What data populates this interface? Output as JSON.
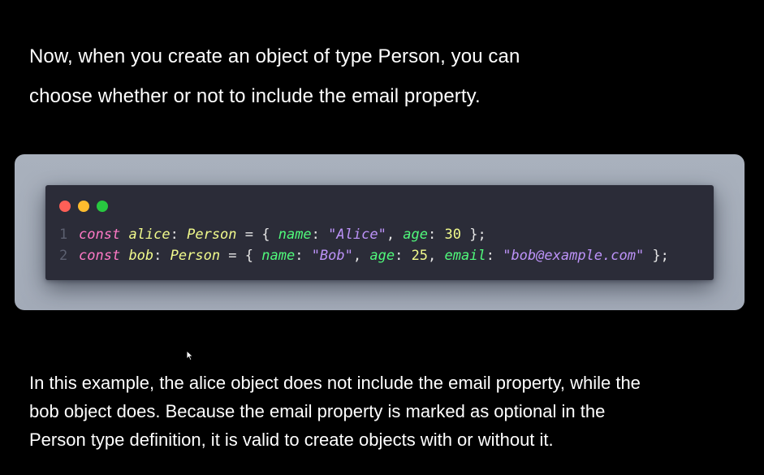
{
  "intro": {
    "line1": "Now, when you create an object of type Person, you can",
    "line2": "choose whether or not to include the email property."
  },
  "code": {
    "window_dots": [
      "red",
      "yellow",
      "green"
    ],
    "lines": [
      {
        "number": "1",
        "tokens": [
          {
            "text": "const",
            "kind": "kw"
          },
          {
            "text": " ",
            "kind": "punc"
          },
          {
            "text": "alice",
            "kind": "var"
          },
          {
            "text": ": ",
            "kind": "punc"
          },
          {
            "text": "Person",
            "kind": "type"
          },
          {
            "text": " = { ",
            "kind": "punc"
          },
          {
            "text": "name",
            "kind": "prop"
          },
          {
            "text": ": ",
            "kind": "punc"
          },
          {
            "text": "\"Alice\"",
            "kind": "str"
          },
          {
            "text": ", ",
            "kind": "punc"
          },
          {
            "text": "age",
            "kind": "prop"
          },
          {
            "text": ": ",
            "kind": "punc"
          },
          {
            "text": "30",
            "kind": "num"
          },
          {
            "text": " };",
            "kind": "punc"
          }
        ]
      },
      {
        "number": "2",
        "tokens": [
          {
            "text": "const",
            "kind": "kw"
          },
          {
            "text": " ",
            "kind": "punc"
          },
          {
            "text": "bob",
            "kind": "var"
          },
          {
            "text": ": ",
            "kind": "punc"
          },
          {
            "text": "Person",
            "kind": "type"
          },
          {
            "text": " = { ",
            "kind": "punc"
          },
          {
            "text": "name",
            "kind": "prop"
          },
          {
            "text": ": ",
            "kind": "punc"
          },
          {
            "text": "\"Bob\"",
            "kind": "str"
          },
          {
            "text": ", ",
            "kind": "punc"
          },
          {
            "text": "age",
            "kind": "prop"
          },
          {
            "text": ": ",
            "kind": "punc"
          },
          {
            "text": "25",
            "kind": "num"
          },
          {
            "text": ", ",
            "kind": "punc"
          },
          {
            "text": "email",
            "kind": "prop"
          },
          {
            "text": ": ",
            "kind": "punc"
          },
          {
            "text": "\"bob@example.com\"",
            "kind": "str"
          },
          {
            "text": " };",
            "kind": "punc"
          }
        ]
      }
    ]
  },
  "outro": {
    "line1": "In this example, the alice object does not include the email property, while the",
    "line2": "bob object does. Because the email property is marked as optional in the",
    "line3": "Person type definition, it is valid to create objects with or without it."
  },
  "colors": {
    "background": "#000000",
    "frame": "#a8b0bc",
    "editor": "#2b2c38",
    "keyword": "#ff79c6",
    "identifier": "#f1fa8c",
    "property": "#50fa7b",
    "string": "#bd93f9"
  },
  "icons": {
    "cursor": "mouse-pointer-icon"
  }
}
